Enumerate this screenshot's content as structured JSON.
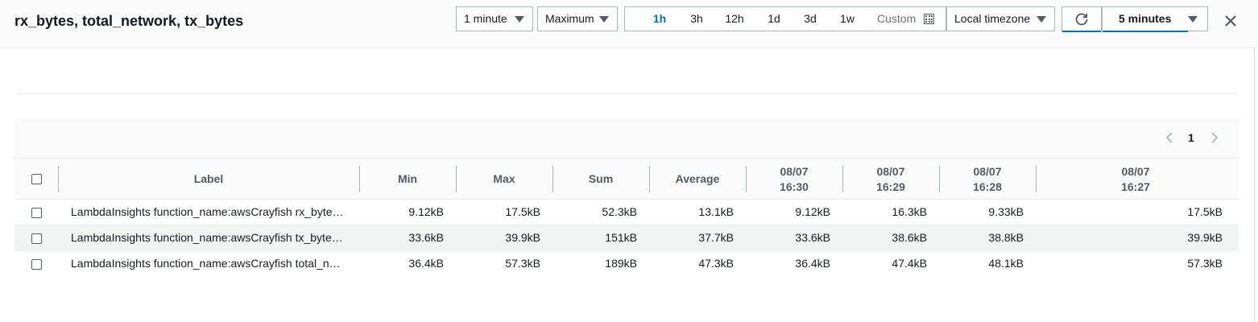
{
  "header": {
    "title": "rx_bytes, total_network, tx_bytes",
    "period": "1 minute",
    "statistic": "Maximum",
    "time_ranges": [
      "1h",
      "3h",
      "12h",
      "1d",
      "3d",
      "1w"
    ],
    "active_range": "1h",
    "custom_label": "Custom",
    "timezone": "Local timezone",
    "refresh_interval": "5 minutes"
  },
  "pager": {
    "current_page": "1"
  },
  "table": {
    "headers": {
      "label": "Label",
      "min": "Min",
      "max": "Max",
      "sum": "Sum",
      "average": "Average",
      "t1_date": "08/07",
      "t1_time": "16:30",
      "t2_date": "08/07",
      "t2_time": "16:29",
      "t3_date": "08/07",
      "t3_time": "16:28",
      "t4_date": "08/07",
      "t4_time": "16:27"
    },
    "rows": [
      {
        "label": "LambdaInsights function_name:awsCrayfish rx_byte…",
        "min": "9.12kB",
        "max": "17.5kB",
        "sum": "52.3kB",
        "average": "13.1kB",
        "t1": "9.12kB",
        "t2": "16.3kB",
        "t3": "9.33kB",
        "t4": "17.5kB"
      },
      {
        "label": "LambdaInsights function_name:awsCrayfish tx_byte…",
        "min": "33.6kB",
        "max": "39.9kB",
        "sum": "151kB",
        "average": "37.7kB",
        "t1": "33.6kB",
        "t2": "38.6kB",
        "t3": "38.8kB",
        "t4": "39.9kB"
      },
      {
        "label": "LambdaInsights function_name:awsCrayfish total_n…",
        "min": "36.4kB",
        "max": "57.3kB",
        "sum": "189kB",
        "average": "47.3kB",
        "t1": "36.4kB",
        "t2": "47.4kB",
        "t3": "48.1kB",
        "t4": "57.3kB"
      }
    ]
  },
  "colors": {
    "accent": "#0073bb",
    "border": "#aab7b8",
    "header_bg": "#fafafa",
    "row_alt": "#f2f3f3"
  }
}
